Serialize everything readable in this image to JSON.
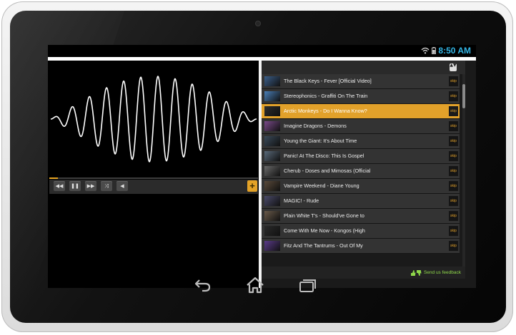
{
  "status_bar": {
    "time": "8:50 AM"
  },
  "player": {
    "controls": [
      {
        "name": "rewind-button",
        "icon": "rewind-icon",
        "glyph": "◀◀"
      },
      {
        "name": "pause-button",
        "icon": "pause-icon",
        "glyph": "❚❚"
      },
      {
        "name": "fast-forward-button",
        "icon": "fast-forward-icon",
        "glyph": "▶▶"
      },
      {
        "name": "shuffle-button",
        "icon": "shuffle-icon",
        "glyph": "⤨"
      },
      {
        "name": "volume-button",
        "icon": "volume-icon",
        "glyph": "◀"
      }
    ],
    "add_glyph": "+",
    "progress_fraction": 0.04
  },
  "playlist": {
    "dropdown_glyph": "▲▼",
    "skip_label": "skip",
    "items": [
      {
        "title": "The Black Keys - Fever [Official Video]",
        "active": false
      },
      {
        "title": "Stereophonics - Graffiti On The Train",
        "active": false
      },
      {
        "title": "Arctic Monkeys - Do I Wanna Know?",
        "active": true
      },
      {
        "title": "Imagine Dragons - Demons",
        "active": false
      },
      {
        "title": "Young the Giant: It's About Time",
        "active": false
      },
      {
        "title": "Panic! At The Disco: This Is Gospel",
        "active": false
      },
      {
        "title": "Cherub - Doses and Mimosas (Official",
        "active": false
      },
      {
        "title": "Vampire Weekend - Diane Young",
        "active": false
      },
      {
        "title": "MAGIC! - Rude",
        "active": false
      },
      {
        "title": "Plain White T's - Should've Gone to",
        "active": false
      },
      {
        "title": "Come With Me Now - Kongos (High",
        "active": false
      },
      {
        "title": "Fitz And The Tantrums - Out Of My",
        "active": false
      }
    ],
    "feedback_label": "Send us feedback"
  },
  "colors": {
    "accent": "#e2a12a",
    "status_time": "#33b5e5",
    "feedback": "#8fd84a"
  },
  "navbar": {
    "buttons": [
      {
        "name": "back-button",
        "icon": "back-icon"
      },
      {
        "name": "home-button",
        "icon": "home-icon"
      },
      {
        "name": "recent-apps-button",
        "icon": "recent-apps-icon"
      }
    ]
  }
}
